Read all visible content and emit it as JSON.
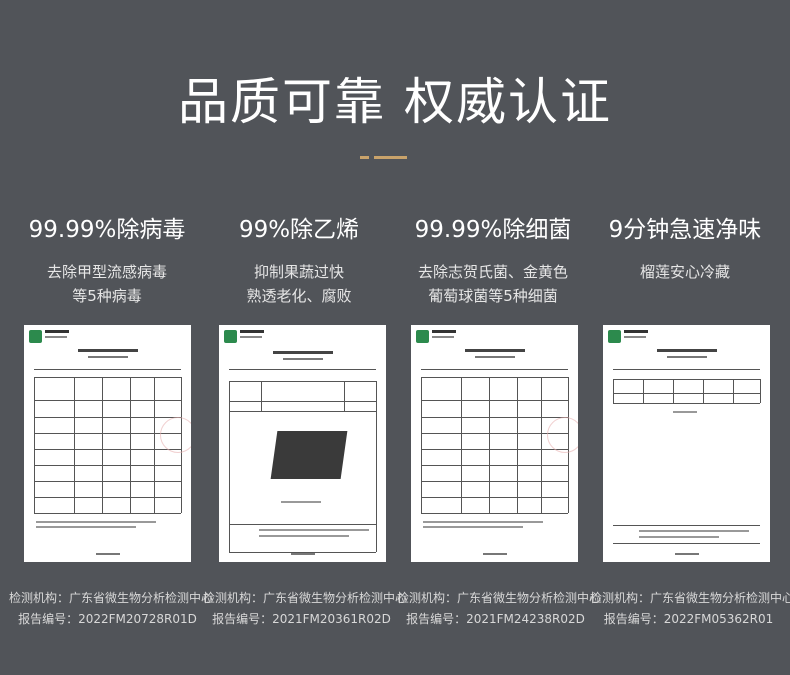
{
  "headline": "品质可靠 权威认证",
  "features": [
    {
      "title": "99.99%除病毒",
      "desc_lines": [
        "去除甲型流感病毒",
        "等5种病毒"
      ]
    },
    {
      "title": "99%除乙烯",
      "desc_lines": [
        "抑制果蔬过快",
        "熟透老化、腐败"
      ]
    },
    {
      "title": "99.99%除细菌",
      "desc_lines": [
        "去除志贺氏菌、金黄色",
        "葡萄球菌等5种细菌"
      ]
    },
    {
      "title": "9分钟急速净味",
      "desc_lines": [
        "榴莲安心冷藏"
      ]
    }
  ],
  "reports": [
    {
      "org": "检测机构：广东省微生物分析检测中心",
      "number": "报告编号：2022FM20728R01D"
    },
    {
      "org": "检测机构：广东省微生物分析检测中心",
      "number": "报告编号：2021FM20361R02D"
    },
    {
      "org": "检测机构：广东省微生物分析检测中心",
      "number": "报告编号：2021FM24238R02D"
    },
    {
      "org": "检测机构：广东省微生物分析检测中心",
      "number": "报告编号：2022FM05362R01"
    }
  ],
  "colors": {
    "background": "#515459",
    "accent": "#c9a36b",
    "logo": "#2c8a4d"
  }
}
